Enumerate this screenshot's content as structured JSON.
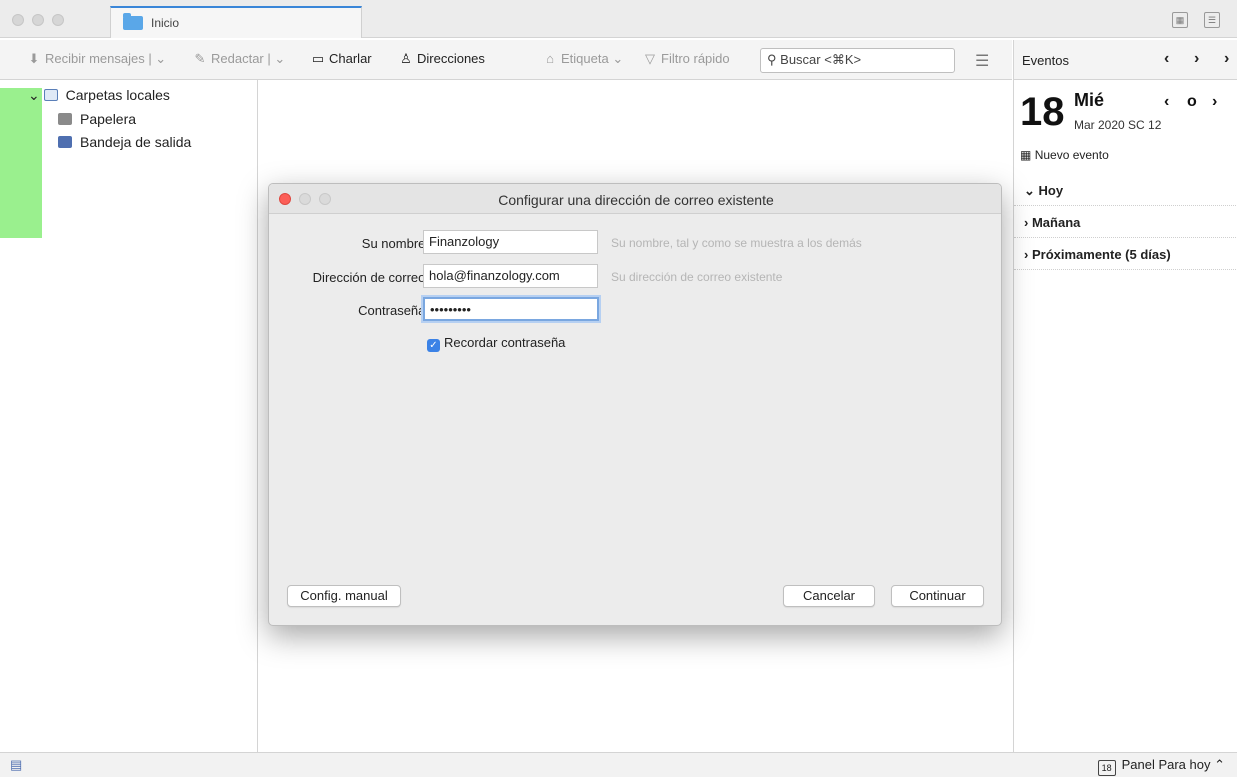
{
  "tab": {
    "label": "Inicio"
  },
  "toolbar": {
    "get_messages": "Recibir mensajes",
    "compose": "Redactar",
    "chat": "Charlar",
    "address_book": "Direcciones",
    "tag": "Etiqueta",
    "quick_filter": "Filtro rápido",
    "search_placeholder": "Buscar <⌘K>"
  },
  "folders": {
    "root": "Carpetas locales",
    "items": [
      {
        "label": "Papelera",
        "icon": "trash-icon"
      },
      {
        "label": "Bandeja de salida",
        "icon": "outbox-icon"
      }
    ]
  },
  "events": {
    "title": "Eventos",
    "day_number": "18",
    "weekday": "Mié",
    "month_week": "Mar 2020  SC 12",
    "new_event": "Nuevo evento",
    "sections": [
      {
        "label": "Hoy",
        "expanded": true
      },
      {
        "label": "Mañana",
        "expanded": false
      },
      {
        "label": "Próximamente (5 días)",
        "expanded": false
      }
    ]
  },
  "statusbar": {
    "panel_label": "Panel Para hoy",
    "cal_day": "18"
  },
  "dialog": {
    "title": "Configurar una dirección de correo existente",
    "name_label": "Su nombre:",
    "name_value": "Finanzology",
    "name_hint": "Su nombre, tal y como se muestra a los demás",
    "email_label": "Dirección de correo:",
    "email_value": "hola@finanzology.com",
    "email_hint": "Su dirección de correo existente",
    "password_label": "Contraseña:",
    "password_value": "•••••••••",
    "remember_label": "Recordar contraseña",
    "remember_checked": true,
    "manual_button": "Config. manual",
    "cancel_button": "Cancelar",
    "continue_button": "Continuar"
  },
  "colors": {
    "accent": "#3b82e6",
    "close_red": "#fc5e57",
    "sidebar_highlight": "#9af08e"
  }
}
